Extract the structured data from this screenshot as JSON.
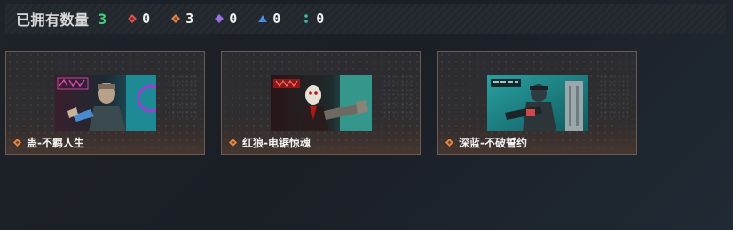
{
  "stats": {
    "label": "已拥有数量",
    "total": "3",
    "items": [
      {
        "icon": "red-diamond-icon",
        "color": "#d9534f",
        "count": "0"
      },
      {
        "icon": "orange-diamond-icon",
        "color": "#e0874a",
        "count": "3"
      },
      {
        "icon": "purple-diamond-icon",
        "color": "#9b6fe0",
        "count": "0"
      },
      {
        "icon": "blue-triangle-icon",
        "color": "#4f8fe0",
        "count": "0"
      },
      {
        "icon": "teal-dots-icon",
        "color": "#3fbfa0",
        "count": "0"
      }
    ]
  },
  "cards": [
    {
      "name": "蛊-不羁人生",
      "rarity_color": "#e0874a"
    },
    {
      "name": "红狼-电锯惊魂",
      "rarity_color": "#e0874a"
    },
    {
      "name": "深蓝-不破誓约",
      "rarity_color": "#e0874a"
    }
  ]
}
